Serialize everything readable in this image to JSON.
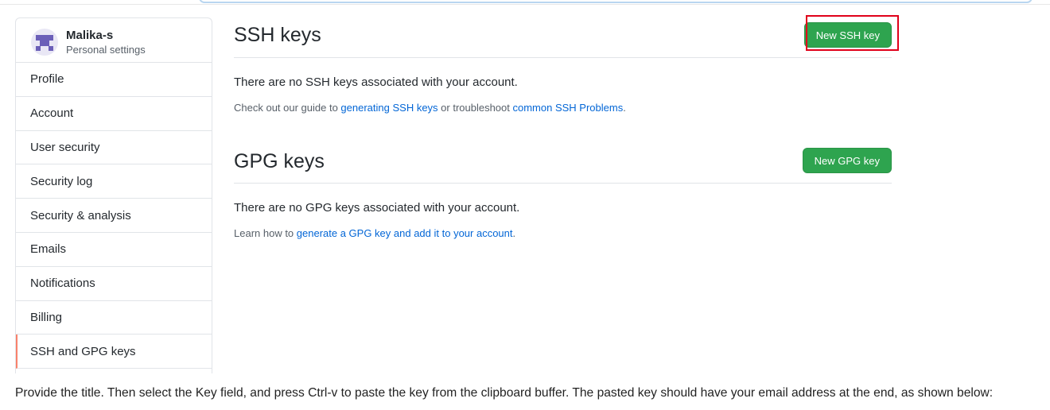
{
  "sidebar": {
    "user_name": "Malika-s",
    "user_subtitle": "Personal settings",
    "items": [
      {
        "label": "Profile"
      },
      {
        "label": "Account"
      },
      {
        "label": "User security"
      },
      {
        "label": "Security log"
      },
      {
        "label": "Security & analysis"
      },
      {
        "label": "Emails"
      },
      {
        "label": "Notifications"
      },
      {
        "label": "Billing"
      },
      {
        "label": "SSH and GPG keys"
      }
    ],
    "selected_item": "SSH and GPG keys",
    "selected_accent_color": "#f9826c"
  },
  "ssh": {
    "title": "SSH keys",
    "button_label": "New SSH key",
    "empty_message": "There are no SSH keys associated with your account.",
    "note_prefix": "Check out our guide to ",
    "link1": "generating SSH keys",
    "note_middle": " or troubleshoot ",
    "link2": "common SSH Problems",
    "note_suffix": "."
  },
  "gpg": {
    "title": "GPG keys",
    "button_label": "New GPG key",
    "empty_message": "There are no GPG keys associated with your account.",
    "note_prefix": "Learn how to ",
    "link1": "generate a GPG key and add it to your account",
    "note_suffix": "."
  },
  "caption": "Provide the title. Then select the Key field, and press Ctrl-v to paste the key from the clipboard buffer. The pasted key should have your email address at the end, as shown below:",
  "colors": {
    "button_green": "#2ea44f",
    "link_blue": "#0366d6",
    "highlight_red": "#e0001a"
  }
}
